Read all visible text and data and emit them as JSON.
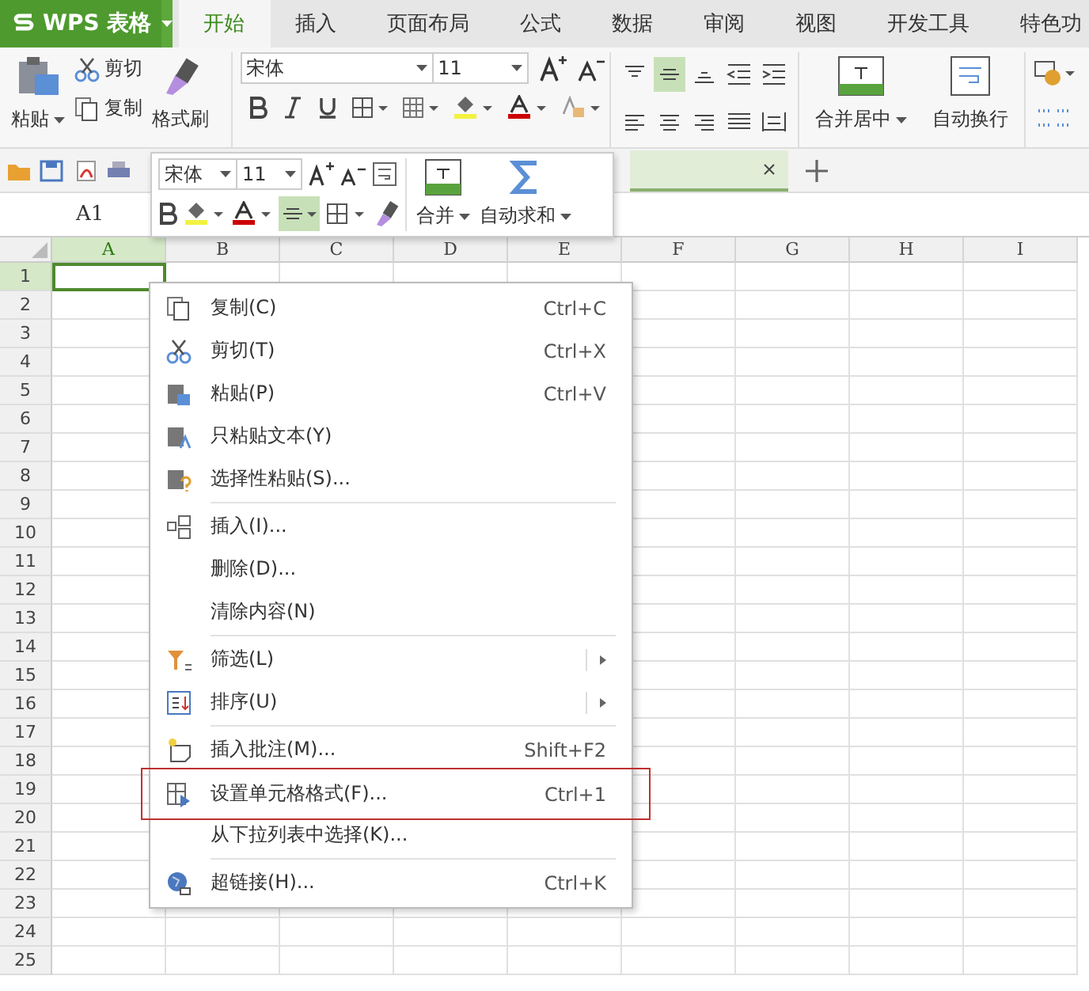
{
  "app": {
    "logo": "WPS 表格"
  },
  "tabs": [
    {
      "label": "开始",
      "selected": true
    },
    {
      "label": "插入",
      "selected": false
    },
    {
      "label": "页面布局",
      "selected": false
    },
    {
      "label": "公式",
      "selected": false
    },
    {
      "label": "数据",
      "selected": false
    },
    {
      "label": "审阅",
      "selected": false
    },
    {
      "label": "视图",
      "selected": false
    },
    {
      "label": "开发工具",
      "selected": false
    },
    {
      "label": "特色功",
      "selected": false
    }
  ],
  "ribbon": {
    "paste": "粘贴",
    "cut": "剪切",
    "copy": "复制",
    "format_painter": "格式刷",
    "font": "宋体",
    "size": "11",
    "alignment": [
      {
        "kind": "top",
        "selected": false
      },
      {
        "kind": "middle",
        "selected": true
      },
      {
        "kind": "bottom",
        "selected": false
      },
      {
        "kind": "left",
        "selected": false
      },
      {
        "kind": "center",
        "selected": false
      },
      {
        "kind": "right",
        "selected": false
      }
    ],
    "merge": "合并居中",
    "wrap": "自动换行"
  },
  "formula_bar": {
    "name_box": "A1"
  },
  "columns": [
    {
      "label": "A",
      "selected": true
    },
    {
      "label": "B",
      "selected": false
    },
    {
      "label": "C",
      "selected": false
    },
    {
      "label": "D",
      "selected": false
    },
    {
      "label": "E",
      "selected": false
    },
    {
      "label": "F",
      "selected": false
    },
    {
      "label": "G",
      "selected": false
    },
    {
      "label": "H",
      "selected": false
    },
    {
      "label": "I",
      "selected": false
    }
  ],
  "rows": [
    {
      "label": "1",
      "selected": true
    },
    {
      "label": "2",
      "selected": false
    },
    {
      "label": "3",
      "selected": false
    },
    {
      "label": "4",
      "selected": false
    },
    {
      "label": "5",
      "selected": false
    },
    {
      "label": "6",
      "selected": false
    },
    {
      "label": "7",
      "selected": false
    },
    {
      "label": "8",
      "selected": false
    },
    {
      "label": "9",
      "selected": false
    },
    {
      "label": "10",
      "selected": false
    },
    {
      "label": "11",
      "selected": false
    },
    {
      "label": "12",
      "selected": false
    },
    {
      "label": "13",
      "selected": false
    },
    {
      "label": "14",
      "selected": false
    },
    {
      "label": "15",
      "selected": false
    },
    {
      "label": "16",
      "selected": false
    },
    {
      "label": "17",
      "selected": false
    },
    {
      "label": "18",
      "selected": false
    },
    {
      "label": "19",
      "selected": false
    },
    {
      "label": "20",
      "selected": false
    },
    {
      "label": "21",
      "selected": false
    },
    {
      "label": "22",
      "selected": false
    },
    {
      "label": "23",
      "selected": false
    },
    {
      "label": "24",
      "selected": false
    },
    {
      "label": "25",
      "selected": false
    }
  ],
  "mini_toolbar": {
    "font": "宋体",
    "size": "11",
    "merge": "合并",
    "autosum": "自动求和",
    "align_selected": true
  },
  "context_menu": {
    "groups": [
      [
        {
          "kind": "copy",
          "label": "复制(C)",
          "shortcut": "Ctrl+C",
          "submenu": false,
          "highlighted": false
        },
        {
          "kind": "cut",
          "label": "剪切(T)",
          "shortcut": "Ctrl+X",
          "submenu": false,
          "highlighted": false
        },
        {
          "kind": "paste",
          "label": "粘贴(P)",
          "shortcut": "Ctrl+V",
          "submenu": false,
          "highlighted": false
        },
        {
          "kind": "paste-text",
          "label": "只粘贴文本(Y)",
          "submenu": false,
          "highlighted": false
        },
        {
          "kind": "paste-special",
          "label": "选择性粘贴(S)...",
          "submenu": false,
          "highlighted": false
        }
      ],
      [
        {
          "kind": "insert",
          "label": "插入(I)...",
          "submenu": false,
          "highlighted": false
        },
        {
          "kind": "none",
          "label": "删除(D)...",
          "submenu": false,
          "highlighted": false
        },
        {
          "kind": "none",
          "label": "清除内容(N)",
          "submenu": false,
          "highlighted": false
        }
      ],
      [
        {
          "kind": "filter",
          "label": "筛选(L)",
          "submenu": true,
          "highlighted": false
        },
        {
          "kind": "sort",
          "label": "排序(U)",
          "submenu": true,
          "highlighted": false
        }
      ],
      [
        {
          "kind": "comment",
          "label": "插入批注(M)...",
          "shortcut": "Shift+F2",
          "submenu": false,
          "highlighted": false
        },
        {
          "kind": "format",
          "label": "设置单元格格式(F)...",
          "shortcut": "Ctrl+1",
          "submenu": false,
          "highlighted": true
        },
        {
          "kind": "none",
          "label": "从下拉列表中选择(K)...",
          "submenu": false,
          "highlighted": false
        }
      ],
      [
        {
          "kind": "hyperlink",
          "label": "超链接(H)...",
          "shortcut": "Ctrl+K",
          "submenu": false,
          "highlighted": false
        }
      ]
    ]
  }
}
